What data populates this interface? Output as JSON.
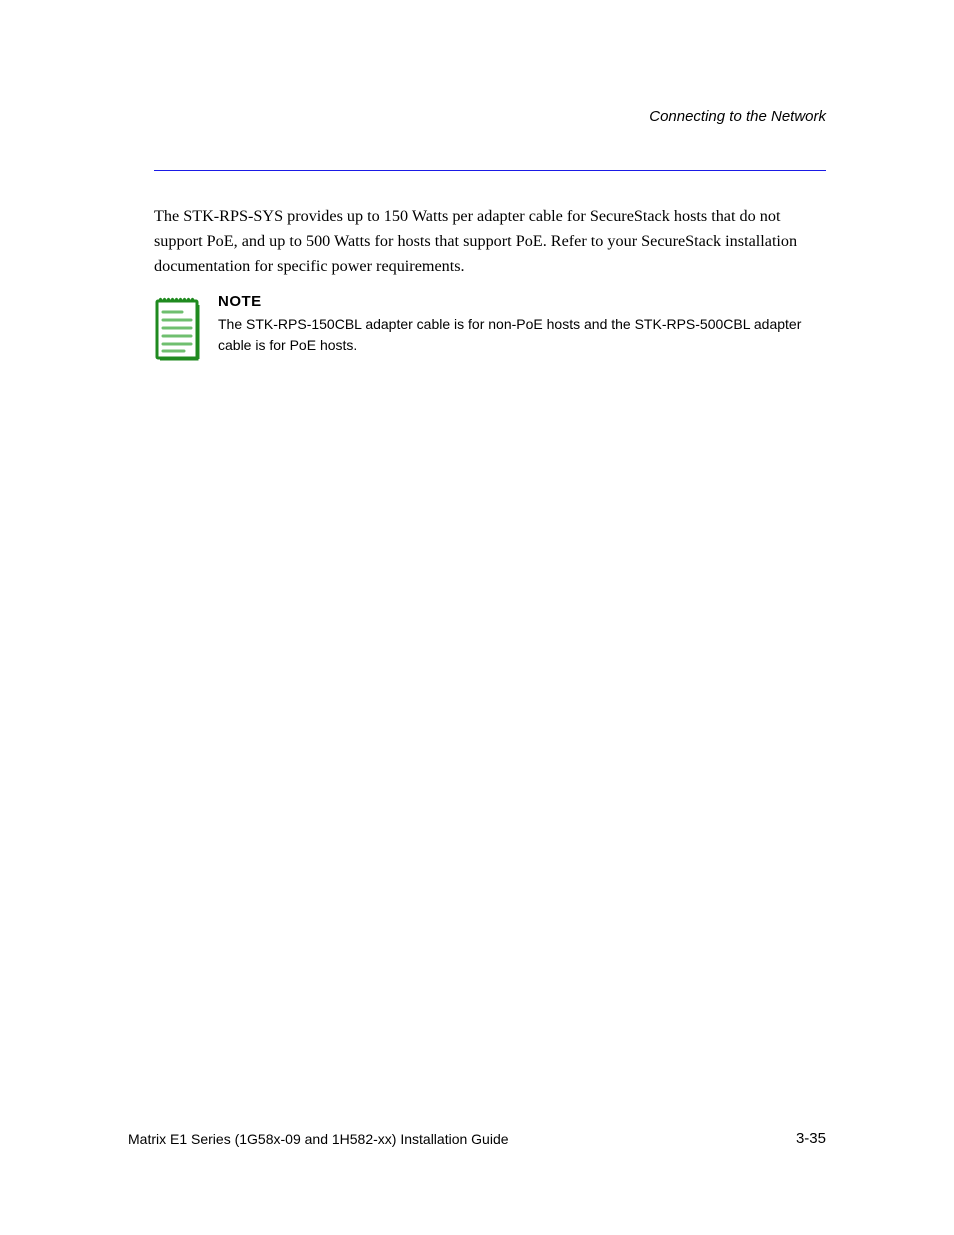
{
  "header": {
    "right": "Connecting to the Network"
  },
  "paragraphs": {
    "p1": "The STK-RPS-SYS provides up to 150 Watts per adapter cable for SecureStack hosts that do not support PoE, and up to 500 Watts for hosts that support PoE. Refer to your SecureStack installation documentation for specific power requirements."
  },
  "note": {
    "label": "NOTE",
    "text": "The STK-RPS-150CBL adapter cable is for non-PoE hosts and the STK-RPS-500CBL adapter cable is for PoE hosts."
  },
  "footer": {
    "left": "Matrix E1 Series (1G58x-09 and 1H582-xx) Installation Guide",
    "right": "3-35"
  },
  "colors": {
    "rule": "#1a1ae6",
    "noteIcon": "#1f8a1f"
  }
}
